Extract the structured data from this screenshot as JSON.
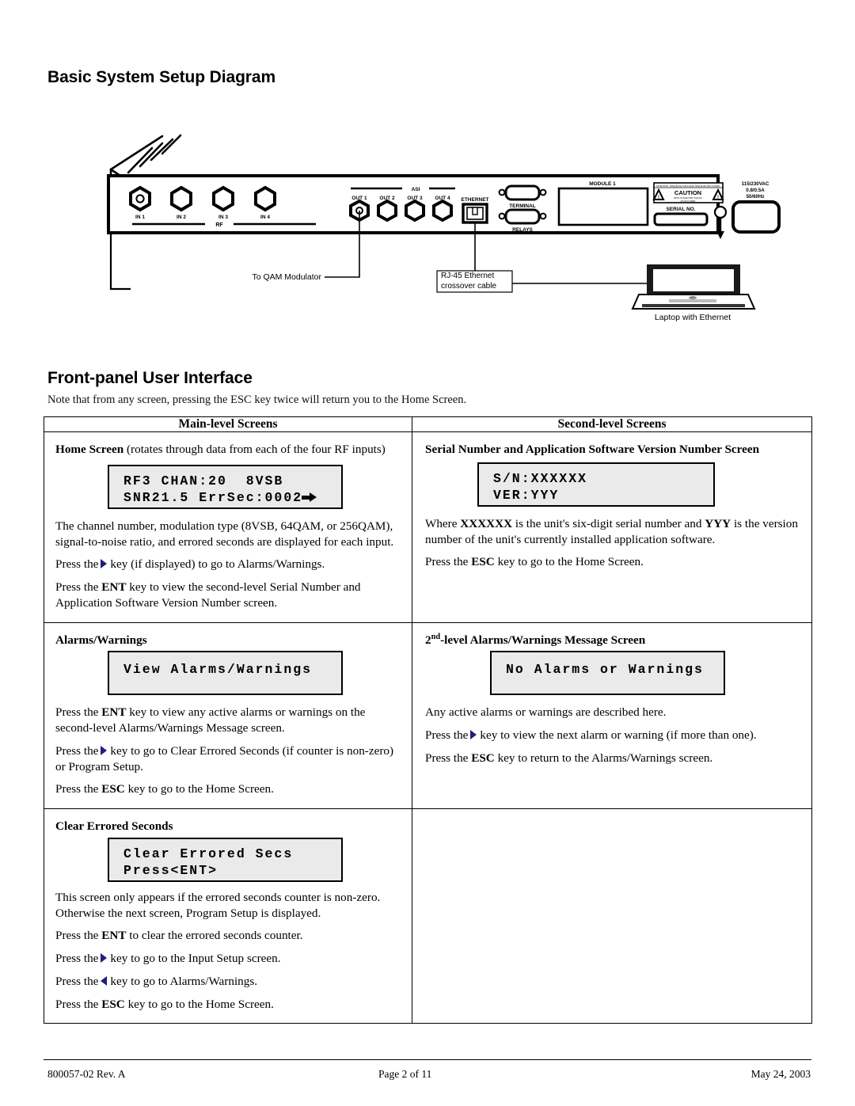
{
  "document": {
    "heading_basic": "Basic System Setup Diagram",
    "heading_front": "Front-panel User Interface",
    "note": "Note that from any screen, pressing the ESC key twice will return you to the Home Screen."
  },
  "diagram": {
    "rf_inputs": [
      "IN 1",
      "IN 2",
      "IN 3",
      "IN 4"
    ],
    "rf_group_label": "RF",
    "asi_group_label": "ASI",
    "asi_outputs": [
      "OUT 1",
      "OUT 2",
      "OUT 3",
      "OUT 4"
    ],
    "ethernet_label": "ETHERNET",
    "terminal_label": "TERMINAL",
    "relays_label": "RELAYS",
    "module_label": "MODULE 1",
    "caution_label": "CAUTION",
    "caution_top_note": "ATTENTION : RISQUE DE CHOC ELECTRIQUE NE PAS OUVRIR",
    "caution_sub_note": "RISK OF ELECTRIC SHOCK DO NOT OPEN",
    "serial_no_label": "SERIAL NO.",
    "power_lines": [
      "115/230VAC",
      "0.8/0.5A",
      "50/60Hz"
    ],
    "callout_qam": "To QAM Modulator",
    "callout_rj45_line1": "RJ-45 Ethernet",
    "callout_rj45_line2": "crossover cable",
    "callout_laptop": "Laptop with Ethernet"
  },
  "table": {
    "headers": {
      "main": "Main-level Screens",
      "second": "Second-level Screens"
    },
    "rows": [
      {
        "left": {
          "title_bold": "Home Screen",
          "title_rest": "(rotates through data from each of the four RF inputs)",
          "lcd_line1": "RF3 CHAN:20  8VSB",
          "lcd_line2": "SNR21.5 ErrSec:0002",
          "p1": "The channel number, modulation type (8VSB, 64QAM, or 256QAM), signal-to-noise ratio, and errored seconds are displayed for each input.",
          "p2_pre": "Press the",
          "p2_post": "key (if displayed) to go to Alarms/Warnings.",
          "p3_pre": "Press the",
          "p3_key": "ENT",
          "p3_post": "key to view the second-level Serial Number and Application Software Version Number screen."
        },
        "right": {
          "title": "Serial Number and Application Software Version Number Screen",
          "lcd_line1": "S/N:XXXXXX",
          "lcd_line2": "VER:YYY",
          "p1_a": "Where",
          "p1_b": "XXXXXX",
          "p1_c": "is the unit's six-digit serial number and",
          "p1_d": "YYY",
          "p1_e": "is the version number of the unit's currently installed application software.",
          "p2_pre": "Press the",
          "p2_key": "ESC",
          "p2_post": "key to go to the Home Screen."
        }
      },
      {
        "left": {
          "title": "Alarms/Warnings",
          "lcd_line1": "View Alarms/Warnings",
          "p1_pre": "Press the",
          "p1_key": "ENT",
          "p1_post": "key to view any active alarms or warnings on the second-level Alarms/Warnings Message screen.",
          "p2_pre": "Press the",
          "p2_post": "key to go to Clear Errored Seconds (if counter is non-zero) or Program Setup.",
          "p3_pre": "Press the",
          "p3_key": "ESC",
          "p3_post": "key to go to the Home Screen."
        },
        "right": {
          "title_sup": "2",
          "title_supmark": "nd",
          "title_rest": "-level Alarms/Warnings Message Screen",
          "lcd_line1": "No Alarms or Warnings",
          "p1": "Any active alarms or warnings are described here.",
          "p2_pre": "Press the",
          "p2_post": "key to view the next alarm or warning (if more than one).",
          "p3_pre": "Press the",
          "p3_key": "ESC",
          "p3_post": "key to return to the Alarms/Warnings screen."
        }
      },
      {
        "left": {
          "title": "Clear Errored Seconds",
          "lcd_line1": "Clear Errored Secs",
          "lcd_line2": "Press<ENT>",
          "p1": "This screen only appears if the errored seconds counter is non-zero. Otherwise the next screen, Program Setup is displayed.",
          "p2_pre": "Press the",
          "p2_key": "ENT",
          "p2_post": "to clear the errored seconds counter.",
          "p3_pre": "Press the",
          "p3_post": "key to go to the Input Setup screen.",
          "p4_pre": "Press the",
          "p4_post": "key to go to Alarms/Warnings.",
          "p5_pre": "Press the",
          "p5_key": "ESC",
          "p5_post": "key to go to the Home Screen."
        },
        "right": {}
      }
    ]
  },
  "footer": {
    "left": "800057-02 Rev. A",
    "center": "Page 2 of 11",
    "right": "May 24, 2003"
  },
  "colors": {
    "key_triangle": "#1f1f7a",
    "lcd_background": "#eaeaea",
    "border": "#000000"
  }
}
